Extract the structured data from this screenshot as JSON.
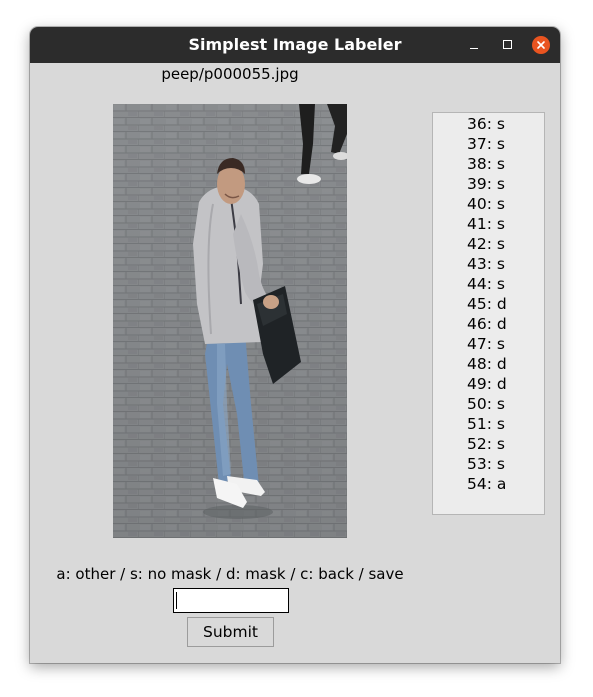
{
  "window": {
    "title": "Simplest Image Labeler"
  },
  "image": {
    "filename": "peep/p000055.jpg"
  },
  "labels": [
    "36: s",
    "37: s",
    "38: s",
    "39: s",
    "40: s",
    "41: s",
    "42: s",
    "43: s",
    "44: s",
    "45: d",
    "46: d",
    "47: s",
    "48: d",
    "49: d",
    "50: s",
    "51: s",
    "52: s",
    "53: s",
    "54: a"
  ],
  "instructions": "a: other / s: no mask / d: mask / c: back / save",
  "entry": {
    "value": ""
  },
  "submit_label": "Submit",
  "colors": {
    "titlebar": "#2c2c2c",
    "close_button": "#e95420",
    "window_bg": "#d9d9d9"
  }
}
